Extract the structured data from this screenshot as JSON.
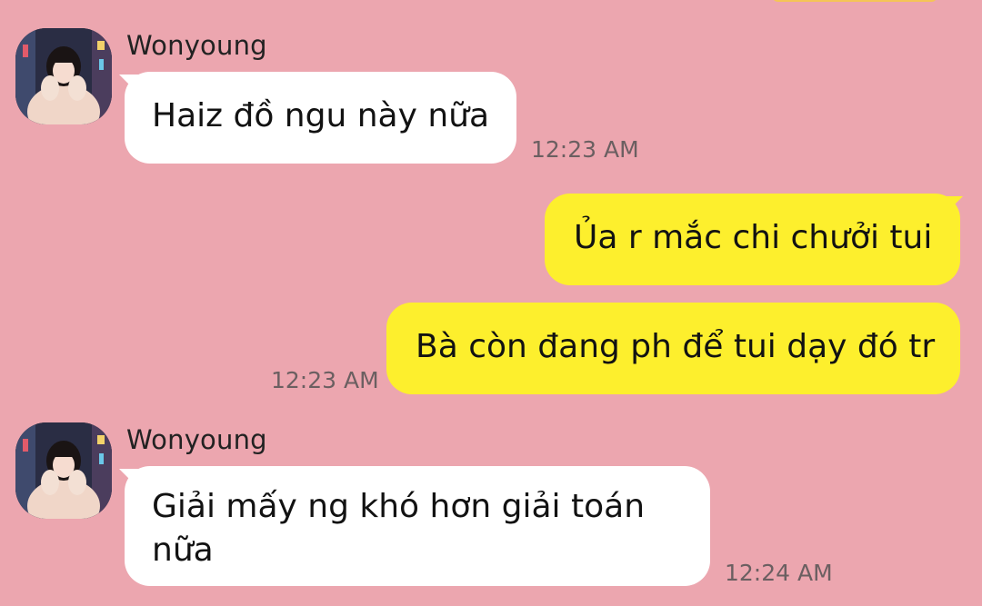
{
  "chat": {
    "messages": [
      {
        "direction": "incoming",
        "sender": "Wonyoung",
        "text": "Haiz đồ ngu này nữa",
        "time": "12:23 AM"
      },
      {
        "direction": "outgoing",
        "text": "Ủa r mắc chi chưởi tui"
      },
      {
        "direction": "outgoing",
        "text": "Bà còn đang ph để tui dạy đó tr",
        "time": "12:23 AM"
      },
      {
        "direction": "incoming",
        "sender": "Wonyoung",
        "text": "Giải mấy ng khó hơn giải toán nữa",
        "time": "12:24 AM"
      }
    ]
  },
  "colors": {
    "background": "#ECA6AF",
    "incoming_bubble": "#FFFFFF",
    "outgoing_bubble": "#FDEF2D"
  }
}
